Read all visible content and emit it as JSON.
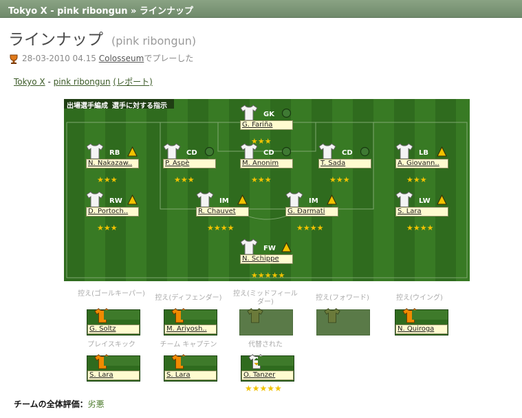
{
  "header": {
    "title": "Tokyo X - pink ribongun » ラインナップ"
  },
  "page": {
    "title": "ラインナップ",
    "subtitle": "(pink ribongun)"
  },
  "match": {
    "datetime": "28-03-2010 04.15",
    "venue": "Colosseum",
    "suffix": "でプレーした"
  },
  "teams": {
    "home": "Tokyo X",
    "sep": " - ",
    "away": "pink ribongun",
    "report": "(レポート)"
  },
  "pitch_tabs": [
    "出場選手編成",
    "選手に対する指示"
  ],
  "players": [
    {
      "pos": "GK",
      "name": "G. Fariña",
      "stars": "★★★",
      "indicator": "circle"
    },
    {
      "pos": "RB",
      "name": "N. Nakazaw..",
      "stars": "★★★",
      "indicator": "triangle"
    },
    {
      "pos": "CD",
      "name": "P. Aspè",
      "stars": "★★★",
      "indicator": "circle"
    },
    {
      "pos": "CD",
      "name": "M. Anonim",
      "stars": "★★★",
      "indicator": "circle"
    },
    {
      "pos": "CD",
      "name": "T. Sada",
      "stars": "★★★",
      "indicator": "circle"
    },
    {
      "pos": "LB",
      "name": "A. Giovann..",
      "stars": "★★★",
      "indicator": "triangle"
    },
    {
      "pos": "RW",
      "name": "D. Portoch..",
      "stars": "★★★",
      "indicator": "triangle"
    },
    {
      "pos": "IM",
      "name": "R. Chauvet",
      "stars": "★★★★",
      "indicator": "triangle"
    },
    {
      "pos": "IM",
      "name": "G. Đarmati",
      "stars": "★★★★",
      "indicator": "triangle"
    },
    {
      "pos": "LW",
      "name": "S. Lara",
      "stars": "★★★★",
      "indicator": "triangle"
    },
    {
      "pos": "FW",
      "name": "N. Schippe",
      "stars": "★★★★★",
      "indicator": "triangle"
    }
  ],
  "bench": [
    {
      "label": "控え(ゴールキーパー)",
      "name": "G. Soltz"
    },
    {
      "label": "控え(ディフェンダー)",
      "name": "M. Ariyosh.."
    },
    {
      "label": "控え(ミッドフィールダー)",
      "name": ""
    },
    {
      "label": "控え(フォワード)",
      "name": ""
    },
    {
      "label": "控え(ウイング)",
      "name": "N. Quiroga"
    },
    {
      "label": "プレイスキック",
      "name": "S. Lara"
    },
    {
      "label": "チーム キャプテン",
      "name": "S. Lara"
    },
    {
      "label": "代替された",
      "name": "O. Tanzer",
      "stars": "★★★★★"
    }
  ],
  "team_rating": {
    "label": "チームの全体評価：",
    "value": "劣悪"
  },
  "colors": {
    "pitch": "#2f6b1e",
    "name_bg": "#fffbd0",
    "star": "#f2c200",
    "triangle": "#f2c200",
    "bench_shirt": "#f08a00"
  },
  "icons": {
    "trophy": "trophy-icon",
    "shirt": "shirt-icon",
    "sub": "substitution-icon"
  }
}
